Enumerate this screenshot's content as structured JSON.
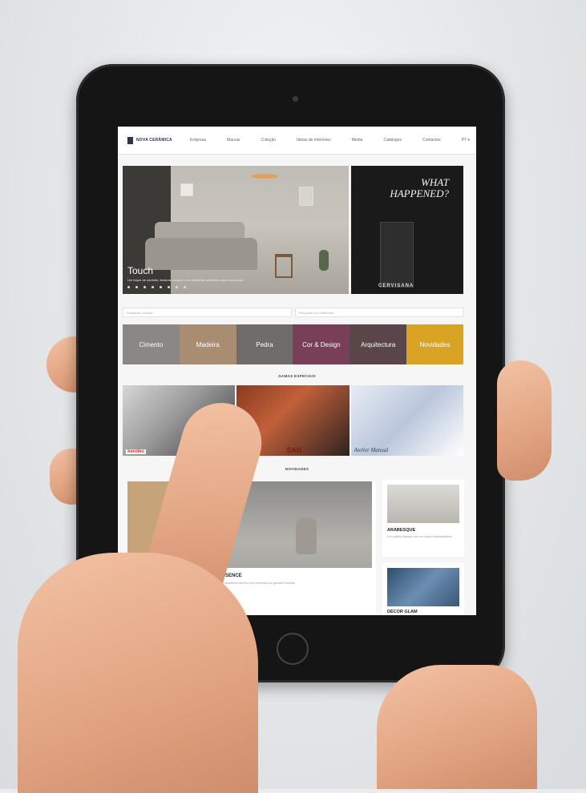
{
  "nav": {
    "logo": "NOVA CERÂMICA",
    "menu": [
      "Empresa",
      "Marcas",
      "Coleção",
      "Ideias de Interiores",
      "Media",
      "Catálogos",
      "Contactos",
      "PT ▾"
    ]
  },
  "hero": {
    "title": "Touch",
    "subtitle": "Um toque de conforto; texturas suaves e um ambiente acolhedor para a sua casa"
  },
  "promo": {
    "headline": "WHAT HAPPENED?",
    "brand": "CERVISANA"
  },
  "search": {
    "collection_placeholder": "Pesquisar coleção",
    "ref_placeholder": "Pesquisar por referência"
  },
  "categories": [
    {
      "label": "Cimento",
      "color": "#8a8886"
    },
    {
      "label": "Madeira",
      "color": "#a88d72"
    },
    {
      "label": "Pedra",
      "color": "#6e6d6b"
    },
    {
      "label": "Cor & Design",
      "color": "#7a3f58"
    },
    {
      "label": "Arquitectura",
      "color": "#5a4548"
    },
    {
      "label": "Novidades",
      "color": "#d9a323"
    }
  ],
  "sections": {
    "gamas": "GAMAS ESPECIAIS",
    "novidades": "NOVIDADES"
  },
  "gamas": [
    {
      "label": "kerotec"
    },
    {
      "label": "SAN"
    },
    {
      "label": "Atelier Manual"
    }
  ],
  "novidades": {
    "main_title": "ESSENCE",
    "main_desc": "Um ambiente sereno com texturas de grande formato",
    "cards": [
      {
        "title": "ARABESQUE",
        "desc": "Um padrão clássico com um toque contemporâneo"
      },
      {
        "title": "DÉCOR GLAM",
        "desc": ""
      }
    ]
  }
}
